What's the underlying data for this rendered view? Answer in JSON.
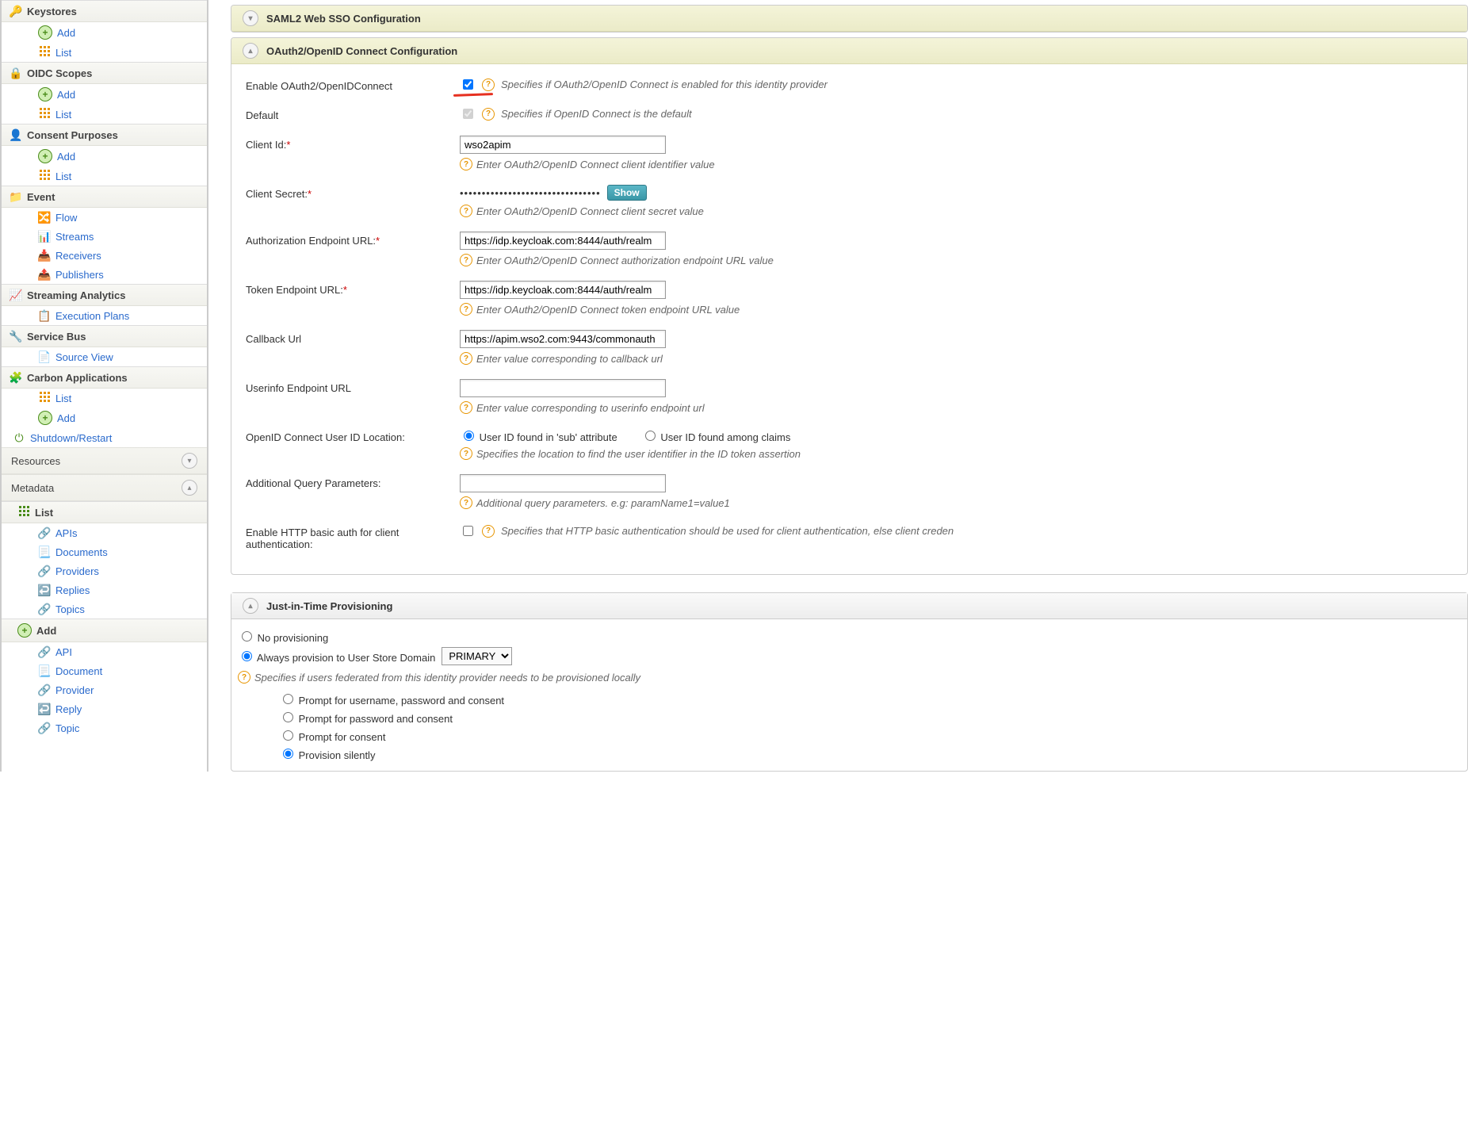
{
  "sidebar": {
    "keystores": {
      "title": "Keystores",
      "add": "Add",
      "list": "List"
    },
    "oidc_scopes": {
      "title": "OIDC Scopes",
      "add": "Add",
      "list": "List"
    },
    "consent": {
      "title": "Consent Purposes",
      "add": "Add",
      "list": "List"
    },
    "event": {
      "title": "Event",
      "flow": "Flow",
      "streams": "Streams",
      "receivers": "Receivers",
      "publishers": "Publishers"
    },
    "streaming": {
      "title": "Streaming Analytics",
      "execution_plans": "Execution Plans"
    },
    "servicebus": {
      "title": "Service Bus",
      "source_view": "Source View"
    },
    "carbon_apps": {
      "title": "Carbon Applications",
      "list": "List",
      "add": "Add"
    },
    "shutdown": "Shutdown/Restart",
    "resources": "Resources",
    "metadata": "Metadata",
    "metadata_list": {
      "title": "List",
      "apis": "APIs",
      "documents": "Documents",
      "providers": "Providers",
      "replies": "Replies",
      "topics": "Topics"
    },
    "metadata_add": {
      "title": "Add",
      "api": "API",
      "document": "Document",
      "provider": "Provider",
      "reply": "Reply",
      "topic": "Topic"
    }
  },
  "main": {
    "saml_panel_title": "SAML2 Web SSO Configuration",
    "oauth_panel_title": "OAuth2/OpenID Connect Configuration",
    "enable_label": "Enable OAuth2/OpenIDConnect",
    "enable_help": "Specifies if OAuth2/OpenID Connect is enabled for this identity provider",
    "default_label": "Default",
    "default_help": "Specifies if OpenID Connect is the default",
    "client_id_label": "Client Id:",
    "client_id_value": "wso2apim",
    "client_id_help": "Enter OAuth2/OpenID Connect client identifier value",
    "client_secret_label": "Client Secret:",
    "client_secret_value": "••••••••••••••••••••••••••••••••",
    "show_button": "Show",
    "client_secret_help": "Enter OAuth2/OpenID Connect client secret value",
    "auth_endpoint_label": "Authorization Endpoint URL:",
    "auth_endpoint_value": "https://idp.keycloak.com:8444/auth/realm",
    "auth_endpoint_help": "Enter OAuth2/OpenID Connect authorization endpoint URL value",
    "token_endpoint_label": "Token Endpoint URL:",
    "token_endpoint_value": "https://idp.keycloak.com:8444/auth/realm",
    "token_endpoint_help": "Enter OAuth2/OpenID Connect token endpoint URL value",
    "callback_label": "Callback Url",
    "callback_value": "https://apim.wso2.com:9443/commonauth",
    "callback_help": "Enter value corresponding to callback url",
    "userinfo_label": "Userinfo Endpoint URL",
    "userinfo_help": "Enter value corresponding to userinfo endpoint url",
    "userid_loc_label": "OpenID Connect User ID Location:",
    "userid_opt1": "User ID found in 'sub' attribute",
    "userid_opt2": "User ID found among claims",
    "userid_help": "Specifies the location to find the user identifier in the ID token assertion",
    "addl_query_label": "Additional Query Parameters:",
    "addl_query_help": "Additional query parameters. e.g: paramName1=value1",
    "basic_auth_label": "Enable HTTP basic auth for client authentication:",
    "basic_auth_help": "Specifies that HTTP basic authentication should be used for client authentication, else client creden",
    "jit_panel_title": "Just-in-Time Provisioning",
    "jit_no_prov": "No provisioning",
    "jit_always_prov": "Always provision to User Store Domain",
    "jit_domain_value": "PRIMARY",
    "jit_help": "Specifies if users federated from this identity provider needs to be provisioned locally",
    "jit_opt1": "Prompt for username, password and consent",
    "jit_opt2": "Prompt for password and consent",
    "jit_opt3": "Prompt for consent",
    "jit_opt4": "Provision silently"
  }
}
